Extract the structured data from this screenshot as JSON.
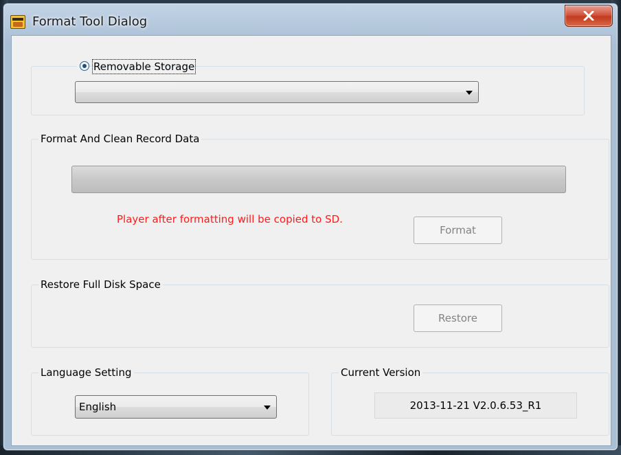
{
  "window": {
    "title": "Format Tool Dialog",
    "close_label": "x"
  },
  "storage": {
    "radio_label": "Removable Storage",
    "radio_selected": true,
    "selected_device": ""
  },
  "format": {
    "group_label": "Format And Clean Record Data",
    "progress": 0,
    "warning": "Player after formatting will be copied to SD.",
    "button_label": "Format"
  },
  "restore": {
    "group_label": "Restore Full Disk Space",
    "button_label": "Restore"
  },
  "language": {
    "group_label": "Language Setting",
    "selected": "English"
  },
  "version": {
    "group_label": "Current Version",
    "value": "2013-11-21 V2.0.6.53_R1"
  },
  "colors": {
    "warning": "#ff1a1a",
    "close_button": "#c13a1f"
  }
}
